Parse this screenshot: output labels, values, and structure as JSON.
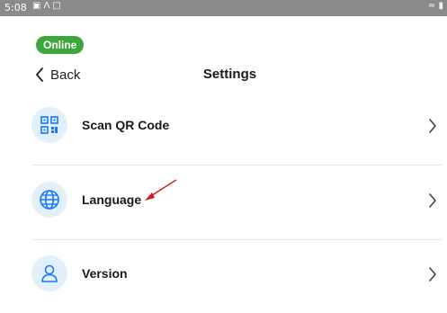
{
  "status_bar": {
    "time": "5:08",
    "icons": [
      "image-icon",
      "signal-icon",
      "screenshot-icon"
    ],
    "right_icons": [
      "wifi-icon",
      "battery-icon"
    ]
  },
  "badge": {
    "label": "Online",
    "color": "#3fa53f"
  },
  "header": {
    "back_label": "Back",
    "title": "Settings"
  },
  "settings": {
    "items": [
      {
        "label": "Scan QR Code",
        "icon": "qr-code-icon"
      },
      {
        "label": "Language",
        "icon": "globe-icon"
      },
      {
        "label": "Version",
        "icon": "user-icon"
      }
    ]
  },
  "colors": {
    "accent": "#1677ff",
    "icon_bg": "#e3f0fb",
    "annotation": "#d01c1c"
  }
}
